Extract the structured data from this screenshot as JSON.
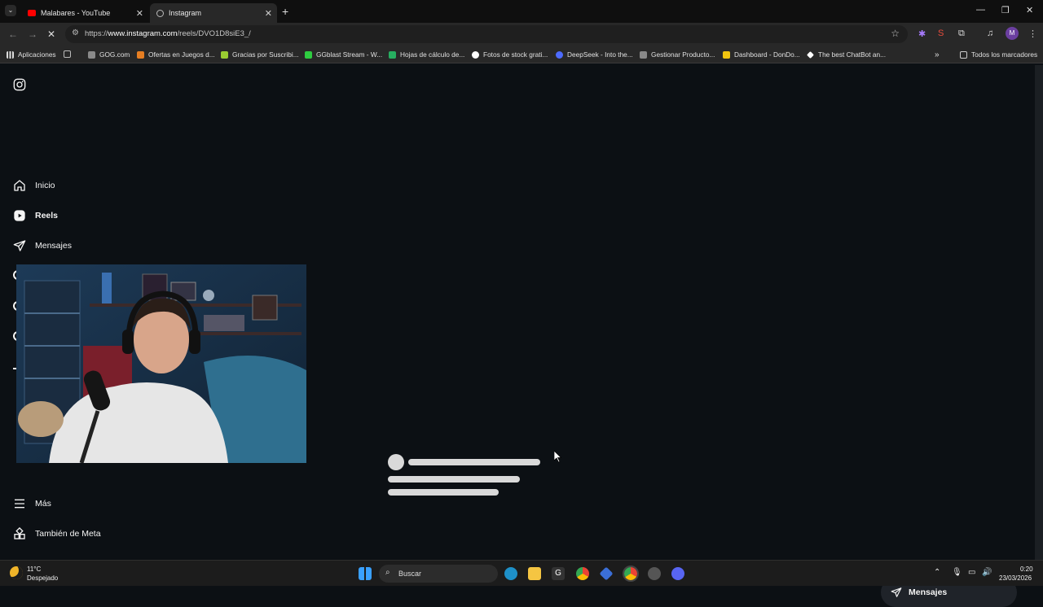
{
  "browser": {
    "tabs": [
      {
        "title": "Malabares - YouTube",
        "active": false
      },
      {
        "title": "Instagram",
        "active": true
      }
    ],
    "url_prefix": "https://",
    "url_host": "www.instagram.com",
    "url_path": "/reels/DVO1D8siE3_/",
    "profile_initial": "M",
    "bookmarks": [
      {
        "label": "Aplicaciones",
        "color": "#e0e0e0"
      },
      {
        "label": "",
        "color": "#bbbbbb"
      },
      {
        "label": "GOG.com",
        "color": "#8a8a8a"
      },
      {
        "label": "Ofertas en Juegos d...",
        "color": "#e67e22"
      },
      {
        "label": "Gracias por Suscribi...",
        "color": "#9acd32"
      },
      {
        "label": "GGblast Stream - W...",
        "color": "#2ecc40"
      },
      {
        "label": "Hojas de cálculo de...",
        "color": "#27ae60"
      },
      {
        "label": "Fotos de stock grati...",
        "color": "#ffffff"
      },
      {
        "label": "DeepSeek - Into the...",
        "color": "#4d6bfe"
      },
      {
        "label": "Gestionar Producto...",
        "color": "#888888"
      },
      {
        "label": "Dashboard - DonDo...",
        "color": "#f1c40f"
      },
      {
        "label": "The best ChatBot an...",
        "color": "#ffffff"
      }
    ],
    "all_bookmarks": "Todos los marcadores"
  },
  "instagram": {
    "nav": [
      {
        "label": "Inicio",
        "icon": "home-icon"
      },
      {
        "label": "Reels",
        "icon": "reels-icon"
      },
      {
        "label": "Mensajes",
        "icon": "messages-icon"
      },
      {
        "label": "Más",
        "icon": "menu-icon"
      },
      {
        "label": "También de Meta",
        "icon": "meta-apps-icon"
      }
    ],
    "messages_button": "Mensajes"
  },
  "taskbar": {
    "weather_temp": "11°C",
    "weather_desc": "Despejado",
    "search_placeholder": "Buscar",
    "time": "0:20",
    "date": "23/03/2026"
  },
  "colors": {
    "page_bg": "#0c1014",
    "skeleton": "#d9d9d9",
    "youtube_red": "#ff0000"
  }
}
